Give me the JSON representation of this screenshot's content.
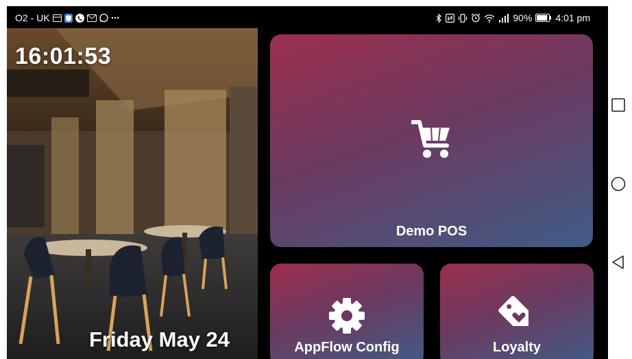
{
  "status_bar": {
    "carrier": "O2 - UK",
    "battery_percent": "90%",
    "time": "4:01 pm",
    "left_icons": [
      "sim-icon",
      "shield-icon",
      "phone-icon",
      "message-icon",
      "whatsapp-icon",
      "more-icon"
    ],
    "right_icons": [
      "bluetooth-icon",
      "nfc-icon",
      "vibrate-icon",
      "alarm-icon",
      "wifi-icon",
      "signal-icon",
      "battery-icon"
    ],
    "battery_level": 0.9
  },
  "clock": {
    "time": "16:01:53"
  },
  "date": {
    "text": "Friday May 24"
  },
  "tiles": [
    {
      "label": "Demo POS",
      "icon": "cart-icon"
    },
    {
      "label": "AppFlow Config",
      "icon": "gear-icon"
    },
    {
      "label": "Loyalty",
      "icon": "tag-heart-icon"
    }
  ],
  "colors": {
    "tile_gradient_start": "#9c2e4e",
    "tile_gradient_end": "#3f5c86",
    "screen_background": "#000000"
  },
  "nav_buttons": [
    "recents-icon",
    "home-icon",
    "back-icon"
  ]
}
